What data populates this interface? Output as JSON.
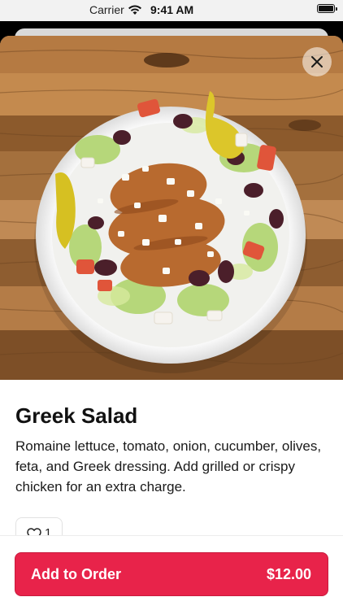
{
  "status_bar": {
    "carrier": "Carrier",
    "time": "9:41 AM"
  },
  "item": {
    "image_icon": "greek-salad-photo",
    "name": "Greek Salad",
    "description": "Romaine lettuce, tomato, onion, cucumber, olives, feta, and Greek dressing. Add grilled or crispy chicken for an extra charge.",
    "likes": "1"
  },
  "footer": {
    "order_label": "Add to Order",
    "price": "$12.00"
  },
  "colors": {
    "accent": "#e8234a",
    "wood": "#9b6a3a",
    "status_bar_bg": "#f2f2f2"
  },
  "icons": {
    "close": "close-icon",
    "heart": "heart-icon",
    "wifi": "wifi-icon",
    "battery": "battery-icon"
  }
}
